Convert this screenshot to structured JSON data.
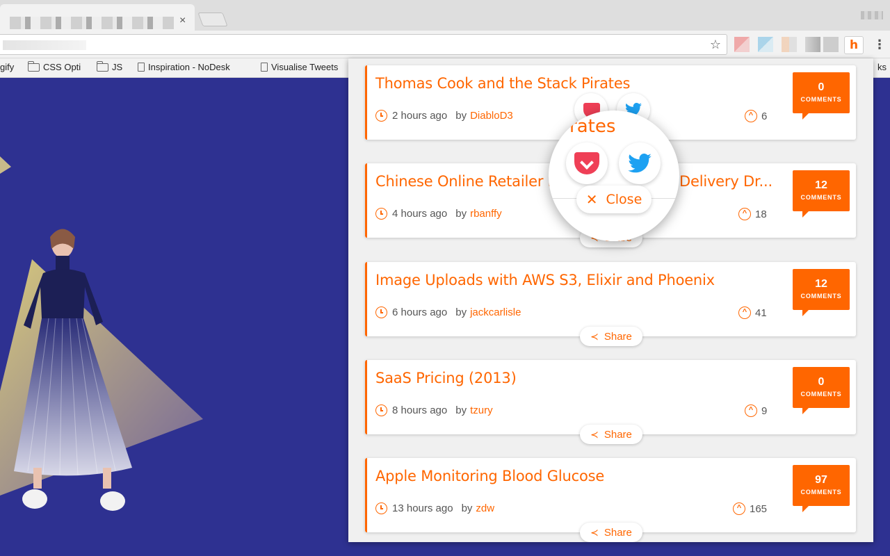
{
  "browser": {
    "tab_close": "×",
    "bookmarks": [
      {
        "label": "gify",
        "icon": "none"
      },
      {
        "label": "CSS Opti",
        "icon": "folder-icon"
      },
      {
        "label": "JS",
        "icon": "folder-icon"
      },
      {
        "label": "Inspiration - NoDesk",
        "icon": "page-icon"
      },
      {
        "label": "Visualise Tweets",
        "icon": "page-icon"
      }
    ],
    "bookmarks_overflow": "ks",
    "extension_label": "h",
    "star_glyph": "☆",
    "kebab_glyph": "⋮"
  },
  "popup": {
    "accent_color": "#ff6600",
    "stories": [
      {
        "title": "Thomas Cook and the Stack Pirates",
        "time": "2 hours ago",
        "by": "by",
        "author": "DiabloD3",
        "points": "6",
        "comments": "0",
        "comments_label": "COMMENTS",
        "share": "Share"
      },
      {
        "title": "Chinese Online Retailer Delivery Dr...",
        "time": "4 hours ago",
        "by": "by",
        "author": "rbanffy",
        "points": "18",
        "comments": "12",
        "comments_label": "COMMENTS",
        "share": "Share"
      },
      {
        "title": "Image Uploads with AWS S3, Elixir and Phoenix",
        "time": "6 hours ago",
        "by": "by",
        "author": "jackcarlisle",
        "points": "41",
        "comments": "12",
        "comments_label": "COMMENTS",
        "share": "Share"
      },
      {
        "title": "SaaS Pricing (2013)",
        "time": "8 hours ago",
        "by": "by",
        "author": "tzury",
        "points": "9",
        "comments": "0",
        "comments_label": "COMMENTS",
        "share": "Share"
      },
      {
        "title": "Apple Monitoring Blood Glucose",
        "time": "13 hours ago",
        "by": "by",
        "author": "zdw",
        "points": "165",
        "comments": "97",
        "comments_label": "COMMENTS",
        "share": "Share"
      }
    ],
    "card2_title_left": "Chinese Online Retailer D",
    "card2_title_right": "Delivery Dr...",
    "magnifier": {
      "title_fragment": "rates",
      "close_label": "Close"
    }
  },
  "background_color": "#2e3191"
}
